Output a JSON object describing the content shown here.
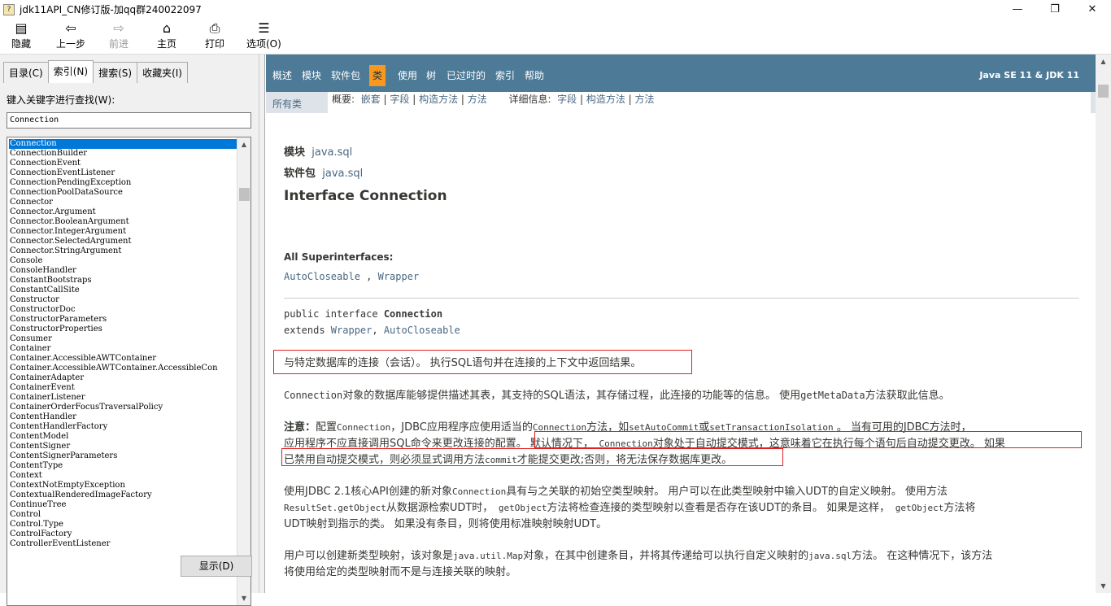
{
  "window": {
    "title": "jdk11API_CN修订版-加qq群240022097",
    "minimize": "—",
    "maximize": "❐",
    "close": "✕"
  },
  "toolbar": {
    "hide": {
      "label": "隐藏",
      "icon": "hide-icon",
      "glyph": "▤"
    },
    "back": {
      "label": "上一步",
      "icon": "back-arrow-icon",
      "glyph": "⇦"
    },
    "forward": {
      "label": "前进",
      "icon": "forward-arrow-icon",
      "glyph": "⇨"
    },
    "home": {
      "label": "主页",
      "icon": "home-icon",
      "glyph": "⌂"
    },
    "print": {
      "label": "打印",
      "icon": "printer-icon",
      "glyph": "⎙"
    },
    "options": {
      "label": "选项(O)",
      "icon": "options-icon",
      "glyph": "☰"
    }
  },
  "left": {
    "tabs": [
      "目录(C)",
      "索引(N)",
      "搜索(S)",
      "收藏夹(I)"
    ],
    "active_tab": 1,
    "keyword_label": "键入关键字进行查找(W):",
    "keyword_value": "Connection",
    "items": [
      "Connection",
      "ConnectionBuilder",
      "ConnectionEvent",
      "ConnectionEventListener",
      "ConnectionPendingException",
      "ConnectionPoolDataSource",
      "Connector",
      "Connector.Argument",
      "Connector.BooleanArgument",
      "Connector.IntegerArgument",
      "Connector.SelectedArgument",
      "Connector.StringArgument",
      "Console",
      "ConsoleHandler",
      "ConstantBootstraps",
      "ConstantCallSite",
      "Constructor",
      "ConstructorDoc",
      "ConstructorParameters",
      "ConstructorProperties",
      "Consumer",
      "Container",
      "Container.AccessibleAWTContainer",
      "Container.AccessibleAWTContainer.AccessibleCon",
      "ContainerAdapter",
      "ContainerEvent",
      "ContainerListener",
      "ContainerOrderFocusTraversalPolicy",
      "ContentHandler",
      "ContentHandlerFactory",
      "ContentModel",
      "ContentSigner",
      "ContentSignerParameters",
      "ContentType",
      "Context",
      "ContextNotEmptyException",
      "ContextualRenderedImageFactory",
      "ContinueTree",
      "Control",
      "Control.Type",
      "ControlFactory",
      "ControllerEventListener"
    ],
    "display_button": "显示(D)"
  },
  "nav": {
    "items": [
      "概述",
      "模块",
      "软件包",
      "类",
      "使用",
      "树",
      "已过时的",
      "索引",
      "帮助"
    ],
    "active": "类",
    "right": "Java SE 11 & JDK 11"
  },
  "subnav": {
    "all_classes": "所有类",
    "summary_label": "概要:",
    "summary_links": [
      "嵌套",
      "字段",
      "构造方法",
      "方法"
    ],
    "detail_label": "详细信息:",
    "detail_links": [
      "字段",
      "构造方法",
      "方法"
    ]
  },
  "doc": {
    "module_label": "模块",
    "module_value": "java.sql",
    "package_label": "软件包",
    "package_value": "java.sql",
    "heading": "Interface Connection",
    "superinterfaces_label": "All Superinterfaces:",
    "superinterface_1": "AutoCloseable",
    "superinterface_sep": " , ",
    "superinterface_2": "Wrapper",
    "decl_line1_kw": "public interface ",
    "decl_line1_name": "Connection",
    "decl_line2_kw": "extends ",
    "decl_line2_a": "Wrapper",
    "decl_line2_sep": ", ",
    "decl_line2_b": "AutoCloseable",
    "p1": "与特定数据库的连接（会话）。 执行SQL语句并在连接的上下文中返回结果。",
    "p2_code1": "Connection",
    "p2_text1": "对象的数据库能够提供描述其表，其支持的SQL语法，其存储过程，此连接的功能等的信息。 使用",
    "p2_code2": "getMetaData",
    "p2_text2": "方法获取此信息。",
    "p3_l1_bold": "注意：",
    "p3_l1_a": "配置",
    "p3_l1_code1": "Connection",
    "p3_l1_b": "，JDBC应用程序应使用适当的",
    "p3_l1_code2": "Connection",
    "p3_l1_c": "方法，如",
    "p3_l1_code3": "setAutoCommit",
    "p3_l1_d": "或",
    "p3_l1_code4": "setTransactionIsolation",
    "p3_l1_e": " 。 当有可用的JDBC方法时，",
    "p3_l2_a": "应用程序不应直接调用SQL命令来更改连接的配置。 默认情况下，",
    "p3_l2_code": " Connection",
    "p3_l2_b": "对象处于自动提交模式，这意味着它在执行每个语句后自动提交更改。 如果",
    "p3_l3_a": "已禁用自动提交模式，则必须显式调用方法",
    "p3_l3_code": "commit",
    "p3_l3_b": "才能提交更改;否则，将无法保存数据库更改。",
    "p4_l1_a": "使用JDBC 2.1核心API创建的新对象",
    "p4_l1_code": "Connection",
    "p4_l1_b": "具有与之关联的初始空类型映射。 用户可以在此类型映射中输入UDT的自定义映射。 使用方法",
    "p4_l2_code1": "ResultSet.getObject",
    "p4_l2_a": "从数据源检索UDT时，",
    "p4_l2_code2": " getObject",
    "p4_l2_b": "方法将检查连接的类型映射以查看是否存在该UDT的条目。 如果是这样，",
    "p4_l2_code3": " getObject",
    "p4_l2_c": "方法将",
    "p4_l3": "UDT映射到指示的类。 如果没有条目，则将使用标准映射映射UDT。",
    "p5_l1_a": "用户可以创建新类型映射，该对象是",
    "p5_l1_code1": "java.util.Map",
    "p5_l1_b": "对象，在其中创建条目，并将其传递给可以执行自定义映射的",
    "p5_l1_code2": "java.sql",
    "p5_l1_c": "方法。 在这种情况下，该方法",
    "p5_l2": "将使用给定的类型映射而不是与连接关联的映射。"
  }
}
